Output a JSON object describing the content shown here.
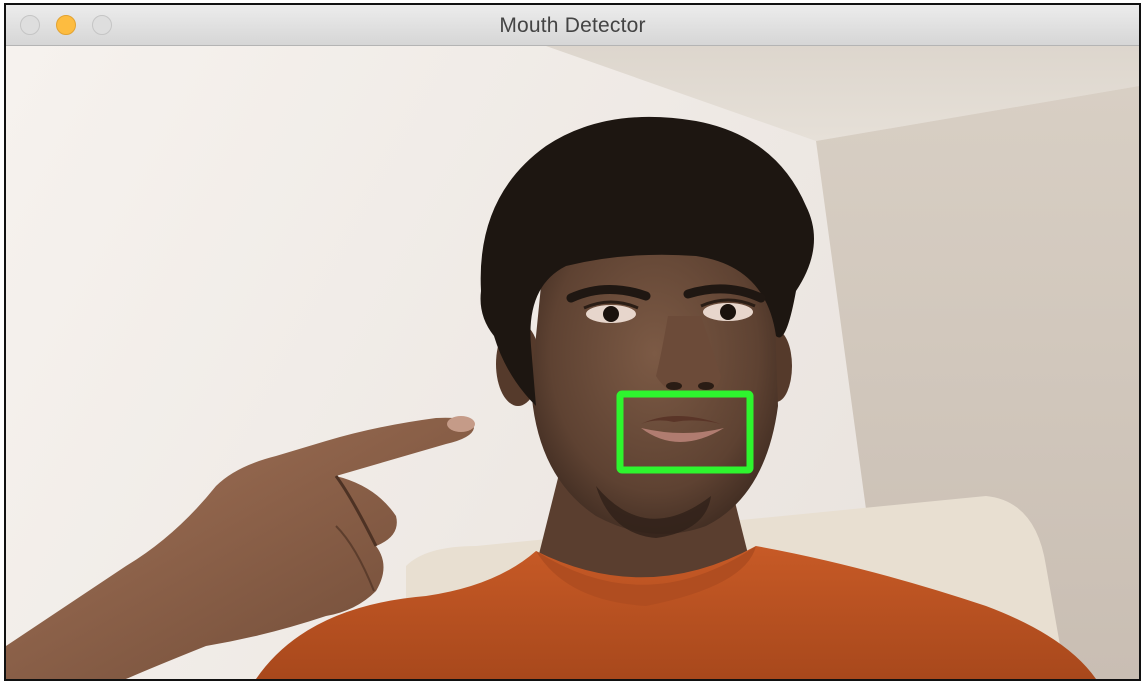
{
  "window": {
    "title": "Mouth Detector",
    "traffic_lights": [
      {
        "name": "close",
        "color": "#dedede"
      },
      {
        "name": "minimize",
        "color": "#fdbc40"
      },
      {
        "name": "zoom",
        "color": "#dedede"
      }
    ]
  },
  "video": {
    "detection_box_color": "#2ef52e",
    "shirt_color": "#c85a26",
    "wall_color": "#f1ece7"
  }
}
